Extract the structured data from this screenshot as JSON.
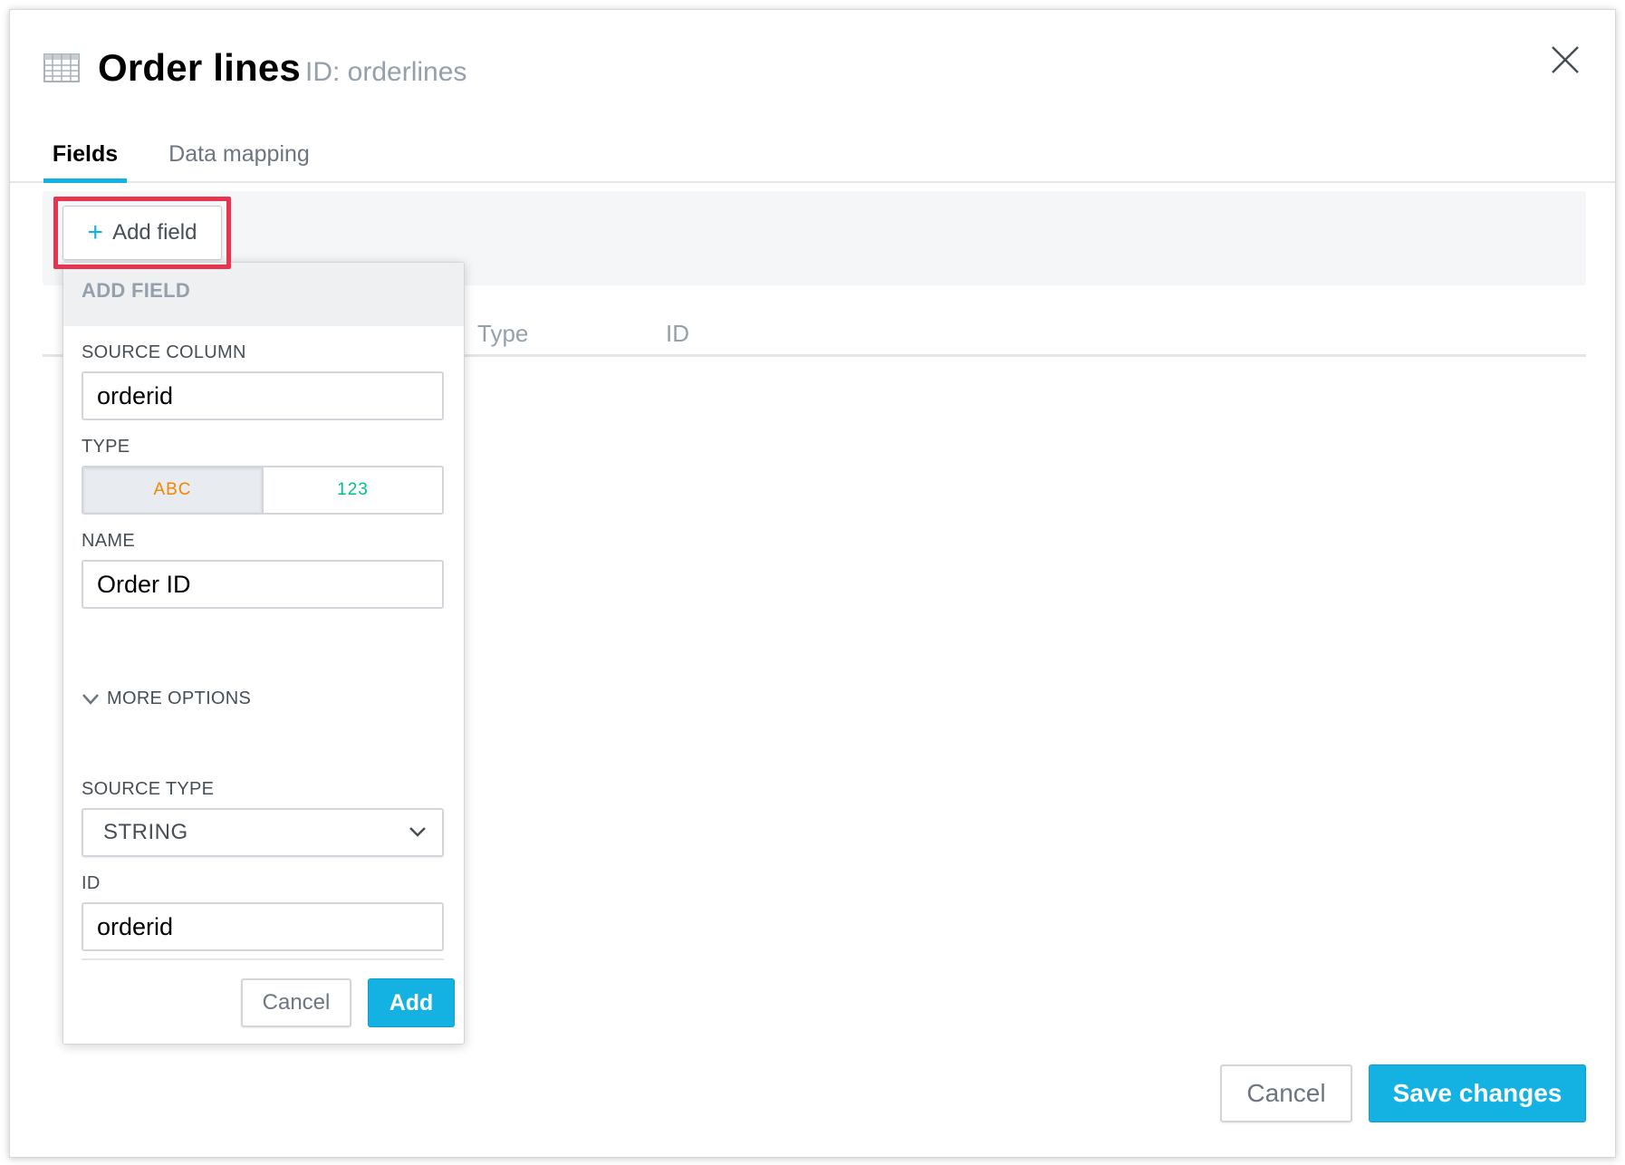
{
  "header": {
    "title": "Order lines",
    "subtitle": "ID: orderlines",
    "icon": "table-grid-icon",
    "close_icon": "close-icon"
  },
  "tabs": [
    {
      "label": "Fields",
      "active": true
    },
    {
      "label": "Data mapping",
      "active": false
    }
  ],
  "toolbar": {
    "add_field_label": "Add field"
  },
  "table": {
    "columns": [
      "Type",
      "ID"
    ]
  },
  "popover": {
    "title": "ADD FIELD",
    "source_column_label": "SOURCE COLUMN",
    "source_column_value": "orderid",
    "type_label": "TYPE",
    "type_options": [
      "ABC",
      "123"
    ],
    "type_selected": "ABC",
    "name_label": "NAME",
    "name_value": "Order ID",
    "more_options_label": "MORE OPTIONS",
    "source_type_label": "SOURCE TYPE",
    "source_type_value": "STRING",
    "id_label": "ID",
    "id_value": "orderid",
    "cancel_label": "Cancel",
    "add_label": "Add"
  },
  "footer": {
    "cancel_label": "Cancel",
    "save_label": "Save changes"
  },
  "colors": {
    "accent": "#14b2e2",
    "highlight": "#e8344f",
    "text_type": "#f18600",
    "numeric_type": "#00c18d"
  }
}
